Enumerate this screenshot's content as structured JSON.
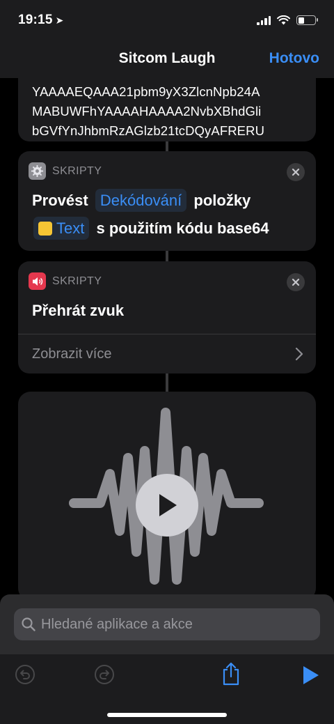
{
  "status": {
    "time": "19:15"
  },
  "nav": {
    "title": "Sitcom Laugh",
    "done_label": "Hotovo"
  },
  "base64_card": {
    "lines": [
      "YAAAAEQAAA21pbm9yX3ZlcnNpb24A",
      "MABUWFhYAAAAHAAAA2NvbXBhdGli",
      "bGVfYnJhbmRzAGlzb21tcDQyAFRERU"
    ]
  },
  "decode_card": {
    "app_label": "SKRIPTY",
    "icon": "gear-icon",
    "text1": "Provést",
    "token_operation": "Dekódování",
    "text2": "položky",
    "token_input": "Text",
    "text3": "s použitím kódu base64"
  },
  "play_card": {
    "app_label": "SKRIPTY",
    "icon": "speaker-icon",
    "action": "Přehrát zvuk",
    "show_more": "Zobrazit více"
  },
  "search": {
    "placeholder": "Hledané aplikace a akce"
  },
  "colors": {
    "accent": "#3a8ef6",
    "card": "#1c1c1e",
    "sound_icon": "#e5384e",
    "note_icon": "#f5c534"
  }
}
